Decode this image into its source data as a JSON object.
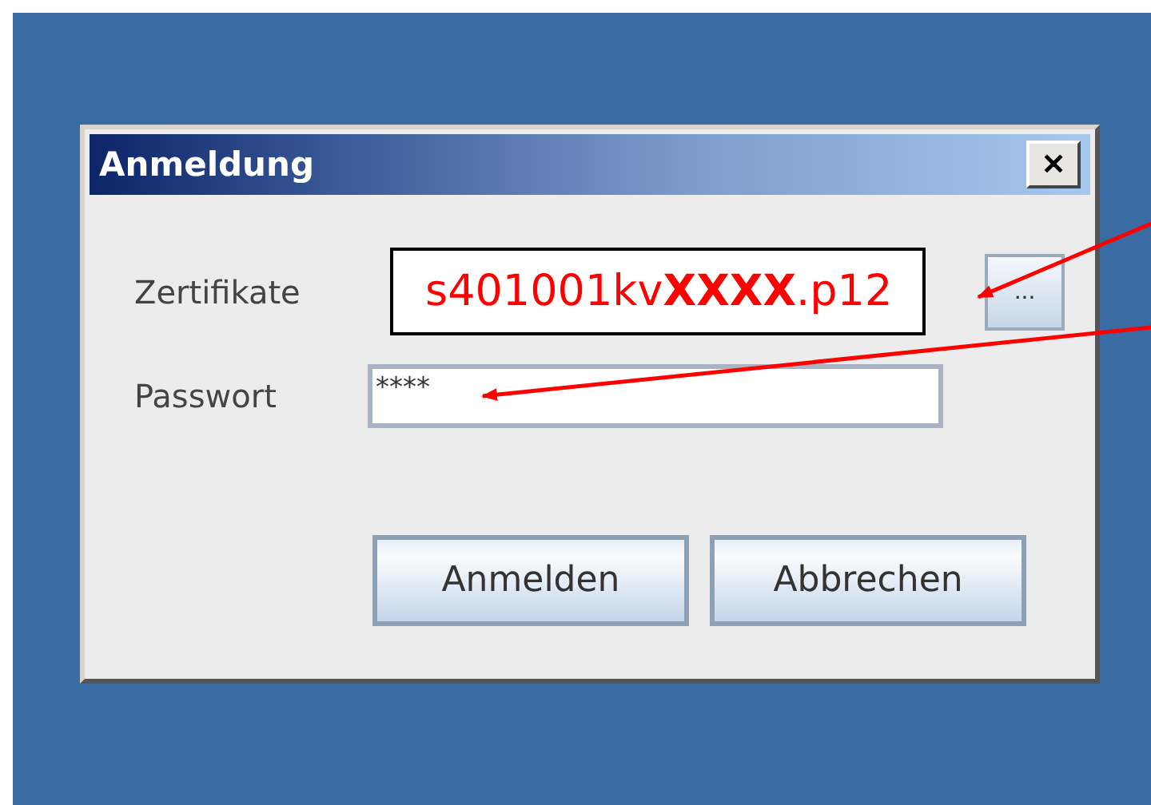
{
  "dialog": {
    "title": "Anmeldung",
    "close": "✕"
  },
  "certificate": {
    "label": "Zertifikate",
    "value": "s401001kv**XXXX**.p12",
    "browse": "..."
  },
  "password": {
    "label": "Passwort",
    "value": "****"
  },
  "buttons": [
    "Anmelden",
    "Abbrechen"
  ]
}
